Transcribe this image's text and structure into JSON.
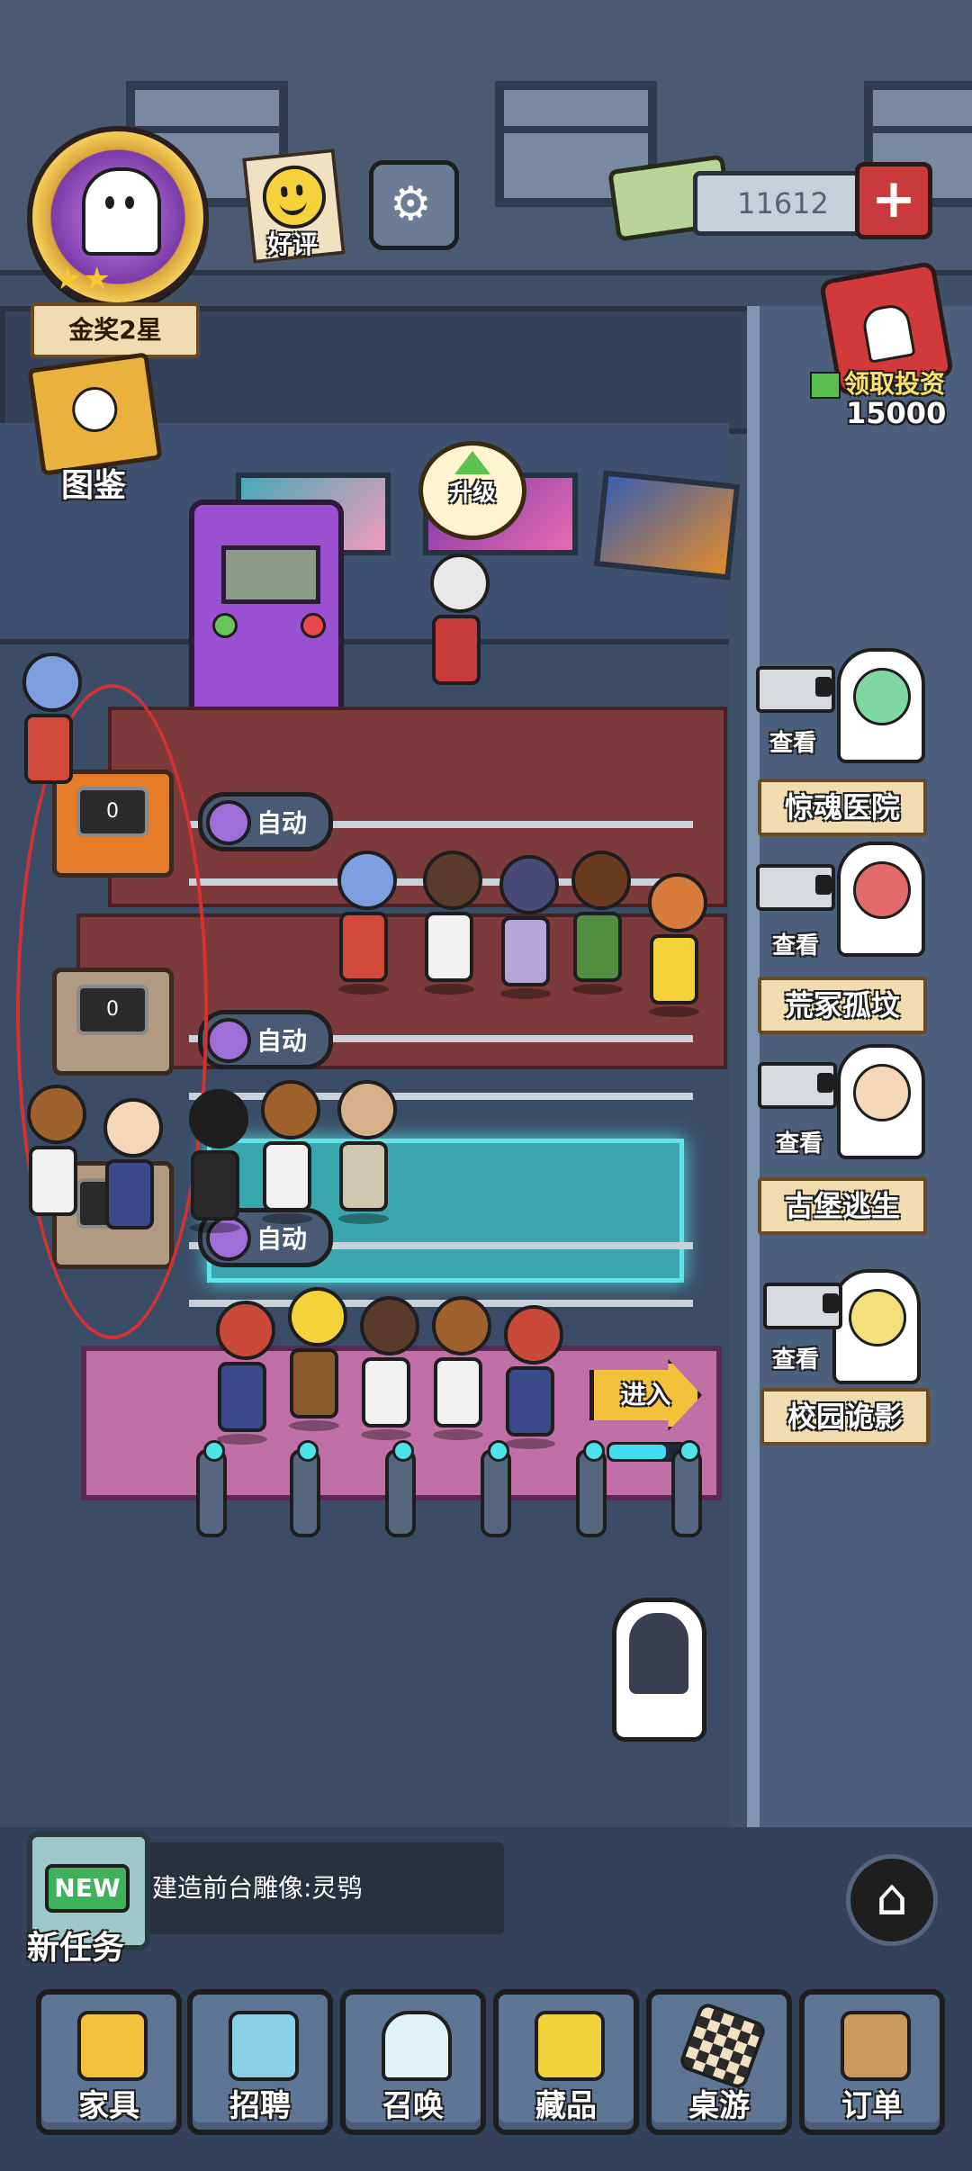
{
  "hud": {
    "rank_label": "金奖2星",
    "rank_stars": "★★",
    "rate_label": "好评",
    "money": "11612",
    "invest_label": "领取投资",
    "invest_amount": "15000",
    "handbook_label": "图鉴"
  },
  "room": {
    "upgrade_label": "升级",
    "lanes": [
      {
        "auto_label": "自动",
        "machine_count": "0"
      },
      {
        "auto_label": "自动",
        "machine_count": "0"
      },
      {
        "auto_label": "自动",
        "machine_count": "0"
      }
    ],
    "enter_label": "进入",
    "enter_progress": 0.75
  },
  "attractions": [
    {
      "view_label": "查看",
      "name": "惊魂医院"
    },
    {
      "view_label": "查看",
      "name": "荒冢孤坟"
    },
    {
      "view_label": "查看",
      "name": "古堡逃生"
    },
    {
      "view_label": "查看",
      "name": "校园诡影"
    }
  ],
  "task": {
    "new_badge": "NEW",
    "label": "新任务",
    "text": "建造前台雕像:灵鸮"
  },
  "nav": [
    {
      "label": "家具",
      "icon": "hammer-icon"
    },
    {
      "label": "招聘",
      "icon": "clipboard-icon"
    },
    {
      "label": "召唤",
      "icon": "ghost-icon"
    },
    {
      "label": "藏品",
      "icon": "safe-icon"
    },
    {
      "label": "桌游",
      "icon": "chessboard-icon"
    },
    {
      "label": "订单",
      "icon": "box-icon"
    }
  ],
  "colors": {
    "accent_red": "#c93a3a",
    "auto_button": "#495a74",
    "progress_fill": "#41dcef",
    "annotation": "#d53131"
  }
}
